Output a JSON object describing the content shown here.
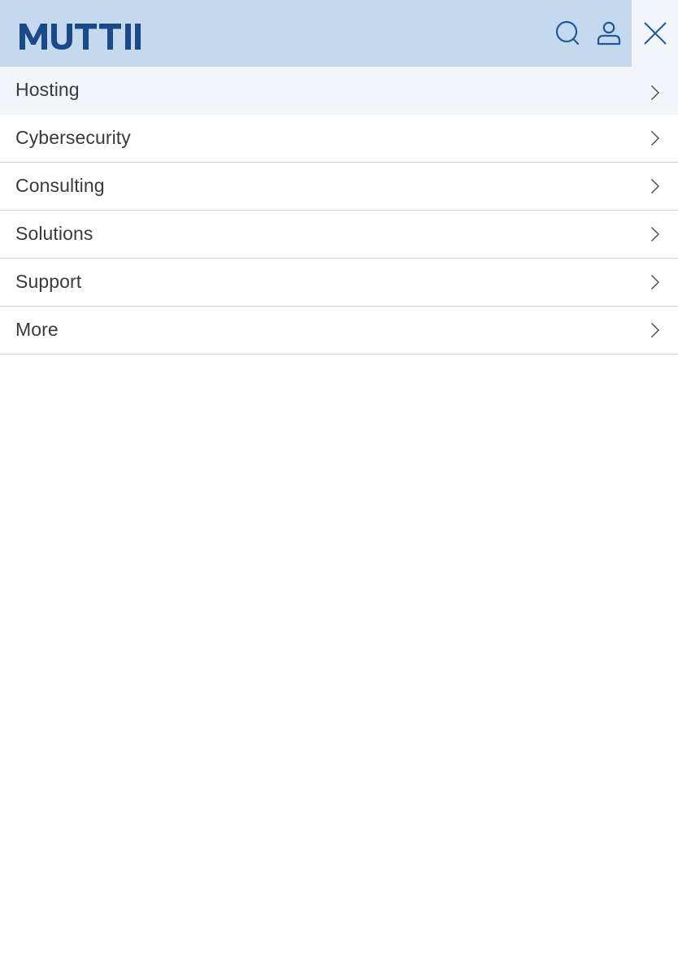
{
  "header": {
    "logo_text": "MUTTII",
    "icons": {
      "search": "search-icon",
      "account": "user-icon",
      "close": "close-icon"
    },
    "colors": {
      "background": "#c5d9ee",
      "logo": "#1a4a8a",
      "icon": "#1e5a9a"
    }
  },
  "menu": {
    "items": [
      {
        "label": "Hosting",
        "active": true
      },
      {
        "label": "Cybersecurity"
      },
      {
        "label": "Consulting"
      },
      {
        "label": "Solutions"
      },
      {
        "label": "Support"
      },
      {
        "label": "More"
      }
    ],
    "chevron_icon": "chevron-right-icon"
  }
}
